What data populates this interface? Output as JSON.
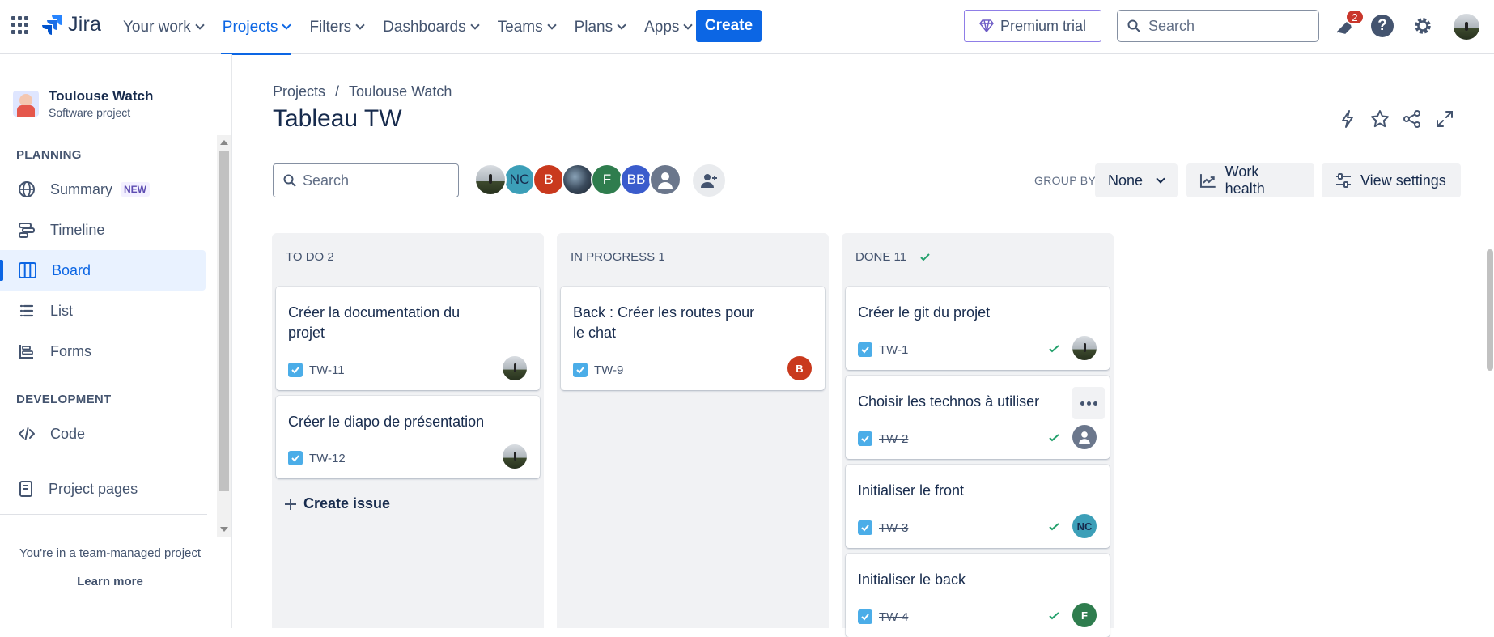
{
  "topnav": {
    "logo_text": "Jira",
    "items": [
      {
        "label": "Your work"
      },
      {
        "label": "Projects"
      },
      {
        "label": "Filters"
      },
      {
        "label": "Dashboards"
      },
      {
        "label": "Teams"
      },
      {
        "label": "Plans"
      },
      {
        "label": "Apps"
      }
    ],
    "active_item": "Projects",
    "create_label": "Create",
    "premium_label": "Premium trial",
    "search_placeholder": "Search",
    "notification_count": "2"
  },
  "sidebar": {
    "project_name": "Toulouse Watch",
    "project_type": "Software project",
    "planning_heading": "PLANNING",
    "planning_items": [
      {
        "label": "Summary",
        "badge": "NEW",
        "icon": "globe-icon"
      },
      {
        "label": "Timeline",
        "icon": "timeline-icon"
      },
      {
        "label": "Board",
        "icon": "board-icon",
        "active": true
      },
      {
        "label": "List",
        "icon": "list-icon"
      },
      {
        "label": "Forms",
        "icon": "forms-icon"
      }
    ],
    "development_heading": "DEVELOPMENT",
    "development_items": [
      {
        "label": "Code",
        "icon": "code-icon"
      }
    ],
    "project_pages_label": "Project pages",
    "team_note": "You're in a team-managed project",
    "learn_more": "Learn more"
  },
  "page": {
    "breadcrumb": [
      "Projects",
      "/",
      "Toulouse Watch"
    ],
    "title": "Tableau TW",
    "board_search_placeholder": "Search",
    "avatars": [
      {
        "label": "",
        "kind": "photo"
      },
      {
        "label": "NC",
        "color": "#3c9fb8"
      },
      {
        "label": "B",
        "color": "#c9391d"
      },
      {
        "label": "",
        "kind": "photo-dark"
      },
      {
        "label": "F",
        "color": "#2f7d4e"
      },
      {
        "label": "BB",
        "color": "#3b5ccc"
      },
      {
        "label": "",
        "kind": "default"
      }
    ],
    "group_by_label": "GROUP BY",
    "group_by_value": "None",
    "work_health_label": "Work health",
    "view_settings_label": "View settings"
  },
  "columns": [
    {
      "title": "TO DO 2",
      "cards": [
        {
          "title": "Créer la documentation du projet",
          "key": "TW-11",
          "done": false,
          "assignee": "photo"
        },
        {
          "title": "Créer le diapo de présentation",
          "key": "TW-12",
          "done": false,
          "assignee": "photo"
        }
      ],
      "create_issue_label": "Create issue"
    },
    {
      "title": "IN PROGRESS 1",
      "cards": [
        {
          "title": "Back : Créer les routes pour le chat",
          "key": "TW-9",
          "done": false,
          "assignee": "B",
          "assignee_color": "#c9391d"
        }
      ]
    },
    {
      "title": "DONE 11",
      "cards": [
        {
          "title": "Créer le git du projet",
          "key": "TW-1",
          "done": true,
          "assignee": "photo"
        },
        {
          "title": "Choisir les technos à utiliser",
          "key": "TW-2",
          "done": true,
          "assignee": "default"
        },
        {
          "title": "Initialiser le front",
          "key": "TW-3",
          "done": true,
          "assignee": "NC",
          "assignee_color": "#3c9fb8"
        },
        {
          "title": "Initialiser le back",
          "key": "TW-4",
          "done": true,
          "assignee": "F",
          "assignee_color": "#2f7d4e"
        }
      ]
    }
  ],
  "colors": {
    "accent": "#0c66e4",
    "done_green": "#22a06b",
    "checkbox_blue": "#4bade8"
  }
}
